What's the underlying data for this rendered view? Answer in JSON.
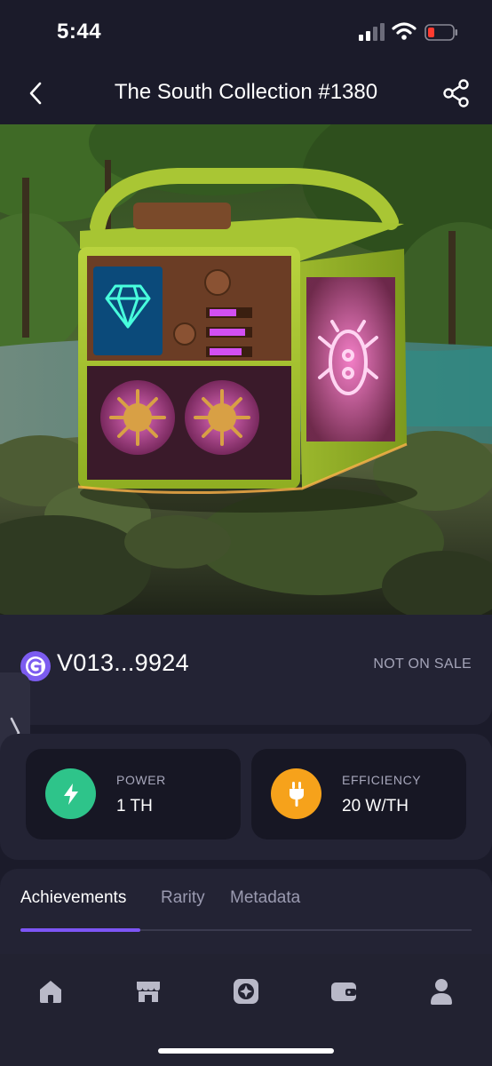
{
  "status_bar": {
    "time": "5:44"
  },
  "header": {
    "title": "The South Collection #1380"
  },
  "owner": {
    "address": "V013...9924",
    "sale_status": "NOT ON SALE"
  },
  "stats": [
    {
      "label": "POWER",
      "value": "1 TH",
      "color": "#2ec48a",
      "icon": "lightning-icon"
    },
    {
      "label": "EFFICIENCY",
      "value": "20 W/TH",
      "color": "#f6a21b",
      "icon": "plug-icon"
    }
  ],
  "tabs": [
    {
      "label": "Achievements",
      "active": true
    },
    {
      "label": "Rarity",
      "active": false
    },
    {
      "label": "Metadata",
      "active": false
    }
  ],
  "bottom_nav": [
    {
      "icon": "home-icon"
    },
    {
      "icon": "store-icon"
    },
    {
      "icon": "miner-icon"
    },
    {
      "icon": "wallet-icon"
    },
    {
      "icon": "profile-icon"
    }
  ],
  "colors": {
    "accent": "#7d55f5",
    "background": "#1b1b2a",
    "card": "#232334"
  }
}
